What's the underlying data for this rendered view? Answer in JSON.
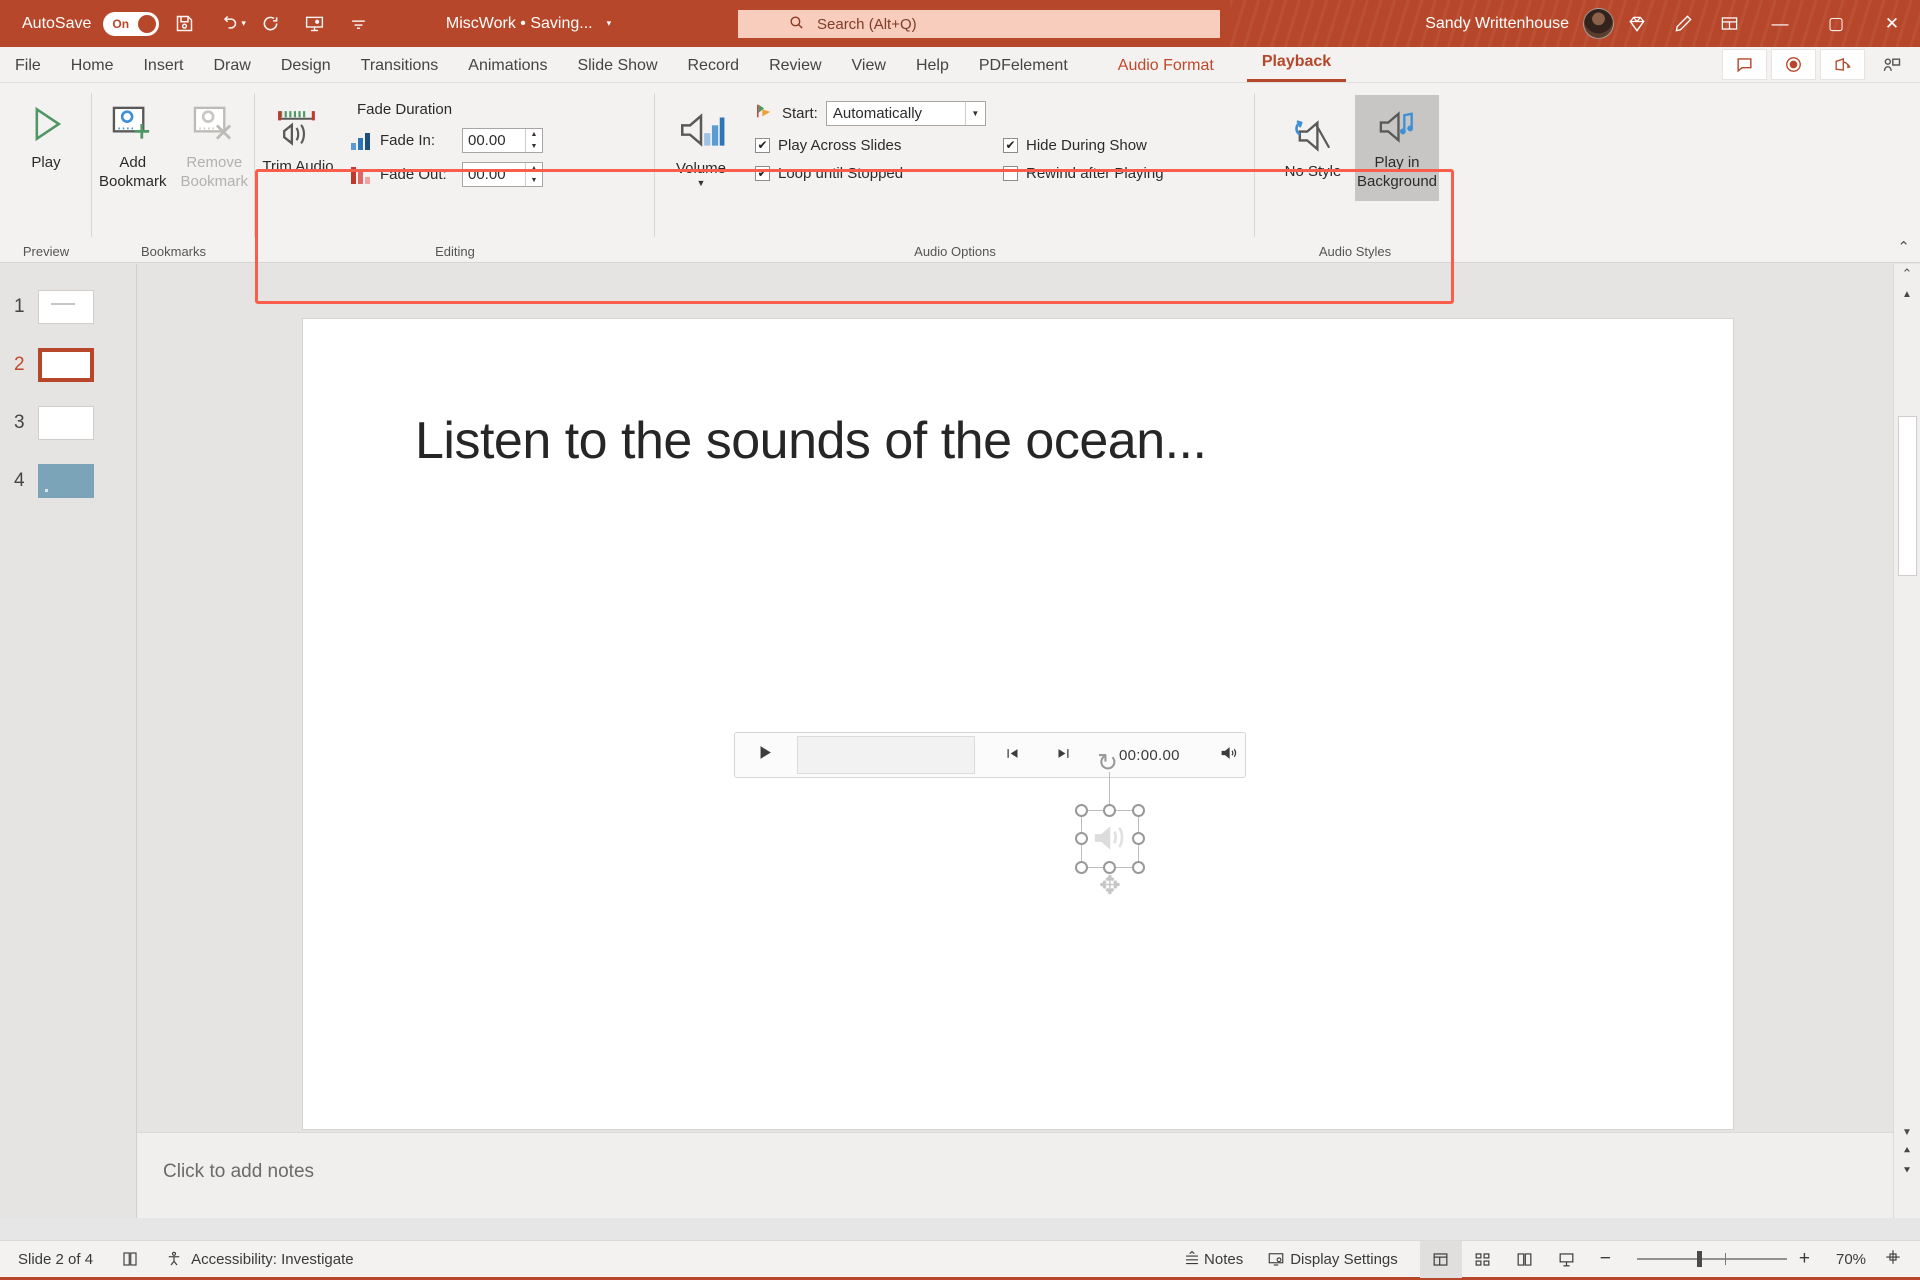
{
  "titlebar": {
    "autosave_label": "AutoSave",
    "autosave_state": "On",
    "save_icon": "save-icon",
    "undo_icon": "undo-icon",
    "redo_icon": "redo-icon",
    "present_icon": "start-presentation-icon",
    "customize_icon": "customize-quick-access-icon",
    "document_name": "MiscWork • Saving...",
    "search_placeholder": "Search (Alt+Q)",
    "user_name": "Sandy Writtenhouse",
    "diamond_icon": "microsoft-365-diamond-icon",
    "pen_icon": "editor-pen-icon",
    "ribbon_display_icon": "ribbon-display-options-icon",
    "minimize_label": "—",
    "maximize_label": "▢",
    "close_label": "✕"
  },
  "tabs": [
    {
      "label": "File",
      "type": "normal"
    },
    {
      "label": "Home",
      "type": "normal"
    },
    {
      "label": "Insert",
      "type": "normal"
    },
    {
      "label": "Draw",
      "type": "normal"
    },
    {
      "label": "Design",
      "type": "normal"
    },
    {
      "label": "Transitions",
      "type": "normal"
    },
    {
      "label": "Animations",
      "type": "normal"
    },
    {
      "label": "Slide Show",
      "type": "normal"
    },
    {
      "label": "Record",
      "type": "normal"
    },
    {
      "label": "Review",
      "type": "normal"
    },
    {
      "label": "View",
      "type": "normal"
    },
    {
      "label": "Help",
      "type": "normal"
    },
    {
      "label": "PDFelement",
      "type": "normal"
    },
    {
      "label": "Audio Format",
      "type": "contextual"
    },
    {
      "label": "Playback",
      "type": "active"
    }
  ],
  "tabbar_buttons": {
    "comments": "comments-icon",
    "record": "record-icon",
    "share": "share-icon",
    "present": "present-in-teams-icon"
  },
  "ribbon": {
    "groups": [
      {
        "name": "Preview",
        "label": "Preview"
      },
      {
        "name": "Bookmarks",
        "label": "Bookmarks"
      },
      {
        "name": "Editing",
        "label": "Editing"
      },
      {
        "name": "AudioOptions",
        "label": "Audio Options"
      },
      {
        "name": "AudioStyles",
        "label": "Audio Styles"
      }
    ],
    "play_button": "Play",
    "add_bookmark": "Add Bookmark",
    "remove_bookmark": "Remove Bookmark",
    "trim_audio": "Trim Audio",
    "fade_duration_title": "Fade Duration",
    "fade_in_label": "Fade In:",
    "fade_in_value": "00.00",
    "fade_out_label": "Fade Out:",
    "fade_out_value": "00.00",
    "volume_label": "Volume",
    "start_label": "Start:",
    "start_value": "Automatically",
    "play_across_slides": "Play Across Slides",
    "loop_until_stopped": "Loop until Stopped",
    "hide_during_show": "Hide During Show",
    "rewind_after_playing": "Rewind after Playing",
    "no_style": "No Style",
    "play_in_background": "Play in Background",
    "checks": {
      "play_across_slides": true,
      "loop_until_stopped": true,
      "hide_during_show": true,
      "rewind_after_playing": false
    },
    "selected_style": "Play in Background",
    "collapse_icon": "collapse-ribbon-icon",
    "highlight_color": "#fa5d4b"
  },
  "thumbnails": [
    {
      "number": "1",
      "active": false,
      "style": "light-with-line"
    },
    {
      "number": "2",
      "active": true,
      "style": "light"
    },
    {
      "number": "3",
      "active": false,
      "style": "light"
    },
    {
      "number": "4",
      "active": false,
      "style": "dark"
    }
  ],
  "slide": {
    "title": "Listen to the sounds of the ocean...",
    "audio_player": {
      "play_icon": "play-icon",
      "back_icon": "step-back-icon",
      "forward_icon": "step-forward-icon",
      "time": "00:00.00",
      "volume_icon": "volume-icon"
    },
    "selected_object": "audio-speaker-object"
  },
  "notes": {
    "placeholder": "Click to add notes"
  },
  "status": {
    "slide_count": "Slide 2 of 4",
    "language_icon": "slide-notes-icon",
    "accessibility": "Accessibility: Investigate",
    "notes_button": "Notes",
    "display_settings": "Display Settings",
    "view_normal": "normal-view-icon",
    "view_sorter": "slide-sorter-icon",
    "view_reading": "reading-view-icon",
    "view_show": "slideshow-view-icon",
    "zoom_out": "−",
    "zoom_in": "+",
    "zoom_level": "70%",
    "fit_icon": "fit-slide-to-window-icon"
  },
  "colors": {
    "brand": "#b7472a",
    "accent_highlight": "#fa5d4b",
    "chrome": "#f3f2f1"
  }
}
